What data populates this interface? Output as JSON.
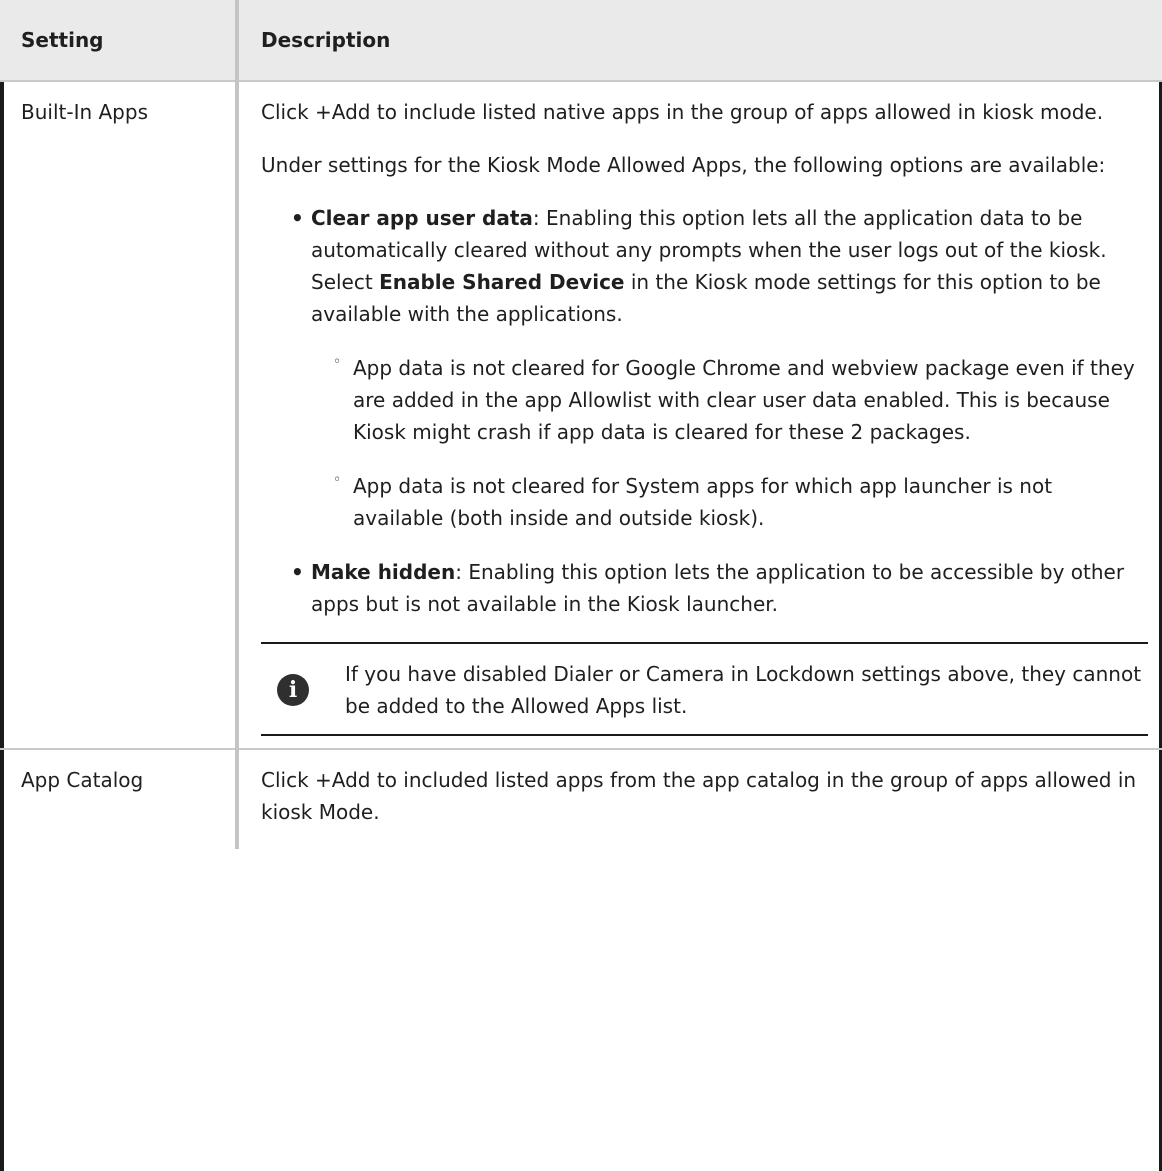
{
  "table": {
    "headers": {
      "setting": "Setting",
      "description": "Description"
    },
    "rows": [
      {
        "setting": "Built-In Apps",
        "intro": "Click +Add to include listed native apps in the group of apps allowed in kiosk mode.",
        "lead": "Under settings for the Kiosk Mode Allowed Apps, the following options are available:",
        "options": [
          {
            "term": "Clear app user data",
            "text": ": Enabling this option lets all the application data to be automatically cleared without any prompts when the user logs out of the kiosk.",
            "line2_prefix": "Select ",
            "line2_bold": "Enable Shared Device",
            "line2_suffix": " in the Kiosk mode settings for this option to be available with the applications.",
            "sub_items": [
              "App data is not cleared for Google Chrome and webview package even if they are added in the app Allowlist with clear user data enabled. This is because Kiosk might crash if app data is cleared for these 2 packages.",
              "App data is not cleared for System apps for which app launcher is not available (both inside and outside kiosk)."
            ]
          },
          {
            "term": "Make hidden",
            "text": ": Enabling this option lets the application to be accessible by other apps but is not available in the Kiosk launcher."
          }
        ],
        "note": {
          "icon": "info-icon",
          "icon_glyph": "i",
          "text": "If you have disabled Dialer or Camera in Lockdown settings above, they cannot be added to the Allowed Apps list."
        }
      },
      {
        "setting": "App Catalog",
        "intro": "Click +Add to included listed apps from the app catalog in the group of apps allowed in kiosk Mode."
      }
    ]
  },
  "bullet_glyph": "•",
  "sub_bullet_glyph": "◦"
}
